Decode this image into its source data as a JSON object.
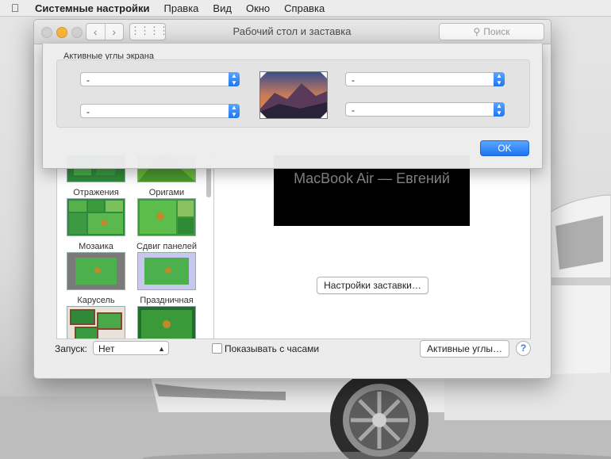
{
  "menubar": {
    "apple_icon": "apple-logo-icon",
    "app_name": "Системные настройки",
    "items": [
      "Правка",
      "Вид",
      "Окно",
      "Справка"
    ]
  },
  "window": {
    "title": "Рабочий стол и заставка",
    "search_placeholder": "Поиск",
    "back_icon": "chevron-left-icon",
    "forward_icon": "chevron-right-icon",
    "grid_icon": "grid-icon"
  },
  "screensavers": [
    {
      "label": "Отражения"
    },
    {
      "label": "Оригами"
    },
    {
      "label": "Мозаика"
    },
    {
      "label": "Сдвиг панелей"
    },
    {
      "label": "Карусель"
    },
    {
      "label": "Праздничная"
    },
    {
      "label": ""
    },
    {
      "label": ""
    }
  ],
  "preview": {
    "computer_name": "MacBook Air — Евгений",
    "options_button": "Настройки заставки…"
  },
  "bottom": {
    "start_label": "Запуск:",
    "start_value": "Нет",
    "show_clock_label": "Показывать с часами",
    "show_clock_checked": false,
    "hot_corners_button": "Активные углы…",
    "help_label": "?"
  },
  "hot_corners_sheet": {
    "group_title": "Активные углы экрана",
    "top_left": "-",
    "bottom_left": "-",
    "top_right": "-",
    "bottom_right": "-",
    "ok_label": "OK"
  },
  "colors": {
    "accent": "#1e76f0",
    "traffic_minimize": "#f5b43b",
    "tile_green": "#3a9a3a"
  }
}
